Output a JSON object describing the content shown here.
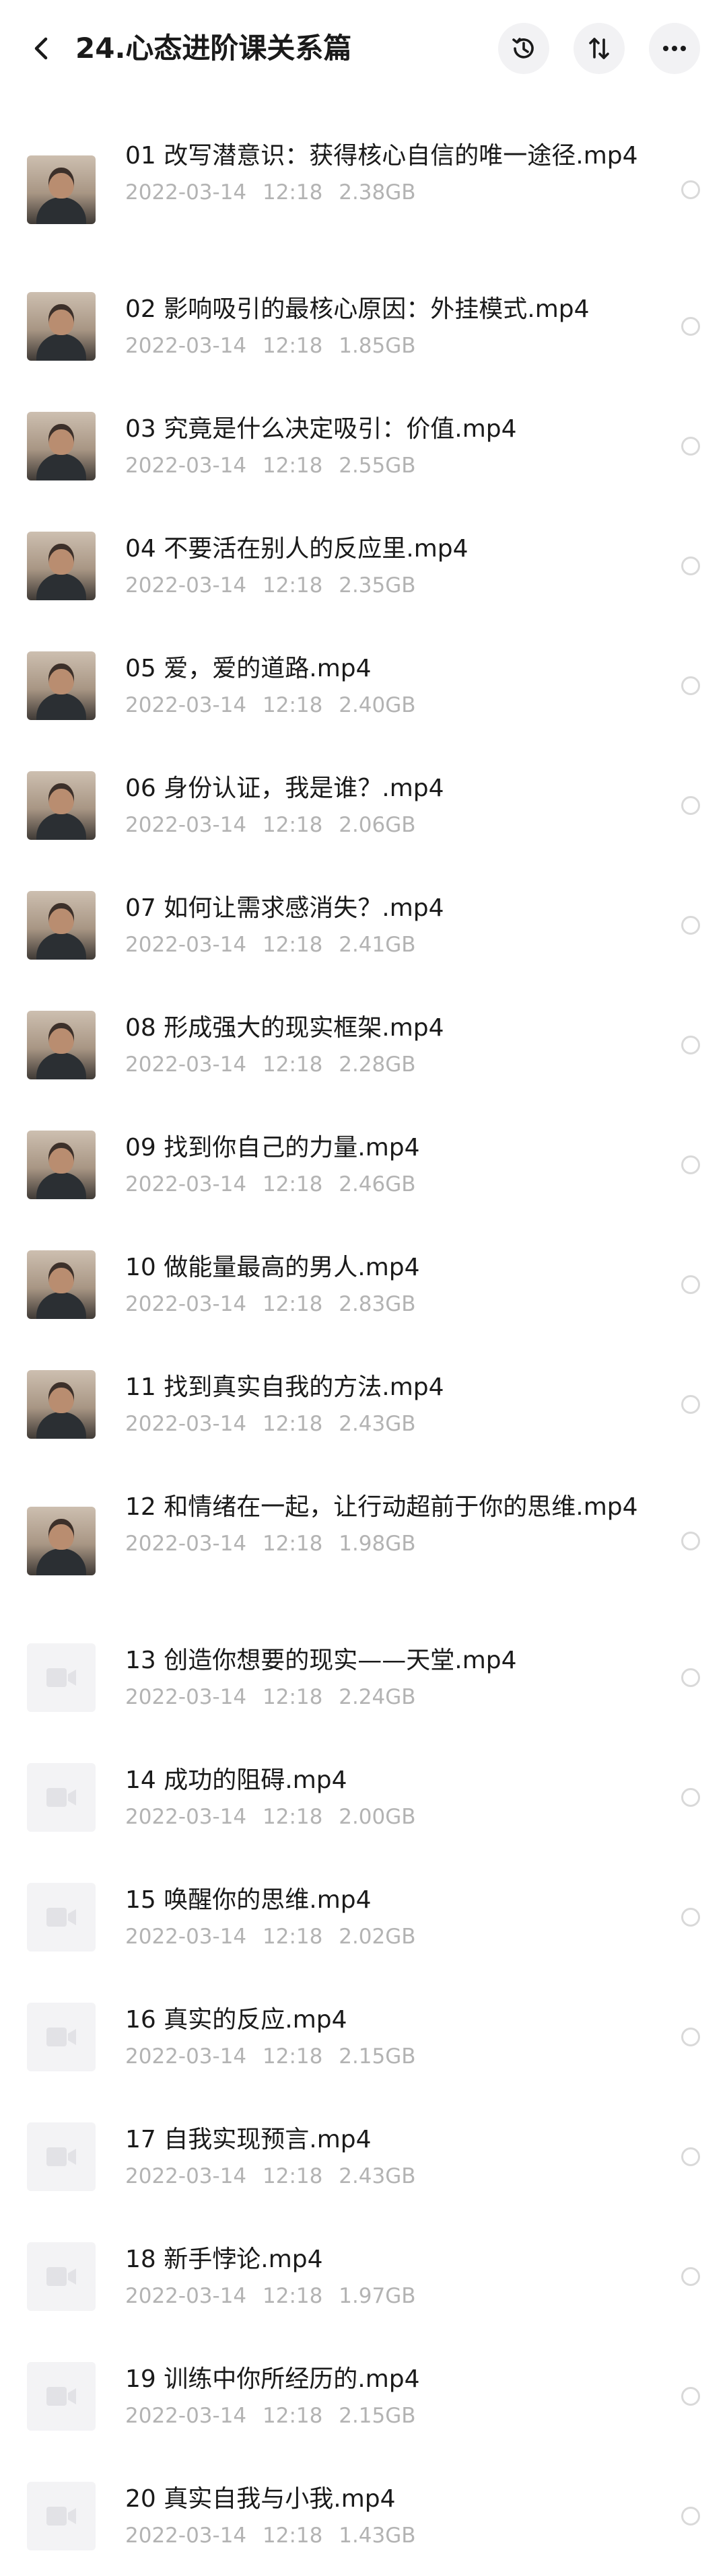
{
  "header": {
    "title": "24.心态进阶课关系篇"
  },
  "files": [
    {
      "name": "01 改写潜意识：获得核心自信的唯一途径.mp4",
      "date": "2022-03-14",
      "time": "12:18",
      "size": "2.38GB",
      "thumb": "photo"
    },
    {
      "name": "02 影响吸引的最核心原因：外挂模式.mp4",
      "date": "2022-03-14",
      "time": "12:18",
      "size": "1.85GB",
      "thumb": "photo"
    },
    {
      "name": "03 究竟是什么决定吸引：价值.mp4",
      "date": "2022-03-14",
      "time": "12:18",
      "size": "2.55GB",
      "thumb": "photo"
    },
    {
      "name": "04 不要活在别人的反应里.mp4",
      "date": "2022-03-14",
      "time": "12:18",
      "size": "2.35GB",
      "thumb": "photo"
    },
    {
      "name": "05 爱，爱的道路.mp4",
      "date": "2022-03-14",
      "time": "12:18",
      "size": "2.40GB",
      "thumb": "photo"
    },
    {
      "name": "06 身份认证，我是谁？.mp4",
      "date": "2022-03-14",
      "time": "12:18",
      "size": "2.06GB",
      "thumb": "photo"
    },
    {
      "name": "07 如何让需求感消失？.mp4",
      "date": "2022-03-14",
      "time": "12:18",
      "size": "2.41GB",
      "thumb": "photo"
    },
    {
      "name": "08 形成强大的现实框架.mp4",
      "date": "2022-03-14",
      "time": "12:18",
      "size": "2.28GB",
      "thumb": "photo"
    },
    {
      "name": "09 找到你自己的力量.mp4",
      "date": "2022-03-14",
      "time": "12:18",
      "size": "2.46GB",
      "thumb": "photo"
    },
    {
      "name": "10 做能量最高的男人.mp4",
      "date": "2022-03-14",
      "time": "12:18",
      "size": "2.83GB",
      "thumb": "photo"
    },
    {
      "name": "11 找到真实自我的方法.mp4",
      "date": "2022-03-14",
      "time": "12:18",
      "size": "2.43GB",
      "thumb": "photo"
    },
    {
      "name": "12 和情绪在一起，让行动超前于你的思维.mp4",
      "date": "2022-03-14",
      "time": "12:18",
      "size": "1.98GB",
      "thumb": "photo"
    },
    {
      "name": "13 创造你想要的现实——天堂.mp4",
      "date": "2022-03-14",
      "time": "12:18",
      "size": "2.24GB",
      "thumb": "placeholder"
    },
    {
      "name": "14 成功的阻碍.mp4",
      "date": "2022-03-14",
      "time": "12:18",
      "size": "2.00GB",
      "thumb": "placeholder"
    },
    {
      "name": "15 唤醒你的思维.mp4",
      "date": "2022-03-14",
      "time": "12:18",
      "size": "2.02GB",
      "thumb": "placeholder"
    },
    {
      "name": "16 真实的反应.mp4",
      "date": "2022-03-14",
      "time": "12:18",
      "size": "2.15GB",
      "thumb": "placeholder"
    },
    {
      "name": "17 自我实现预言.mp4",
      "date": "2022-03-14",
      "time": "12:18",
      "size": "2.43GB",
      "thumb": "placeholder"
    },
    {
      "name": "18 新手悖论.mp4",
      "date": "2022-03-14",
      "time": "12:18",
      "size": "1.97GB",
      "thumb": "placeholder"
    },
    {
      "name": "19 训练中你所经历的.mp4",
      "date": "2022-03-14",
      "time": "12:18",
      "size": "2.15GB",
      "thumb": "placeholder"
    },
    {
      "name": "20 真实自我与小我.mp4",
      "date": "2022-03-14",
      "time": "12:18",
      "size": "1.43GB",
      "thumb": "placeholder"
    }
  ]
}
